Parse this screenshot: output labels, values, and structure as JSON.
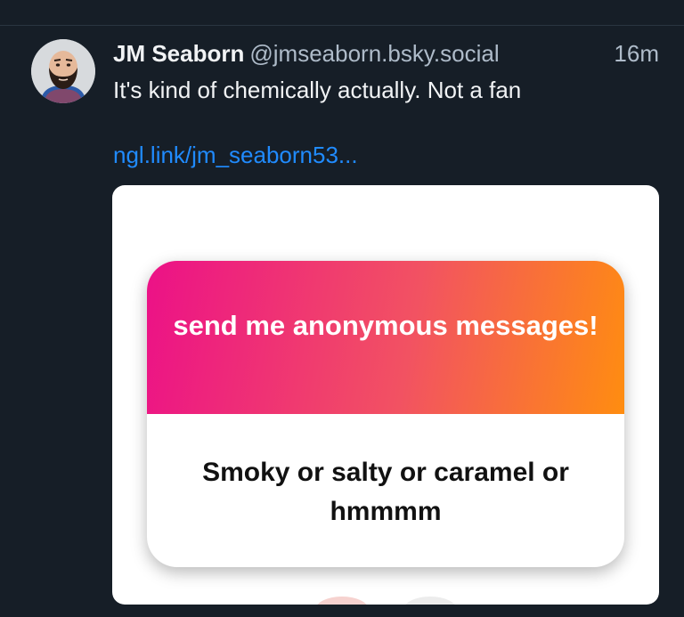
{
  "post": {
    "author_name": "JM Seaborn",
    "author_handle": "@jmseaborn.bsky.social",
    "timestamp": "16m",
    "text": "It's kind of chemically actually. Not a fan",
    "link_text": "ngl.link/jm_seaborn53..."
  },
  "embed": {
    "card_title": "send me anonymous messages!",
    "card_question": "Smoky or salty or caramel or hmmmm"
  },
  "colors": {
    "background": "#161e27",
    "link": "#208bfe",
    "text_primary": "#f1f3f5",
    "text_secondary": "#aebbc9",
    "gradient_start": "#ec1187",
    "gradient_end": "#ff8d10"
  }
}
